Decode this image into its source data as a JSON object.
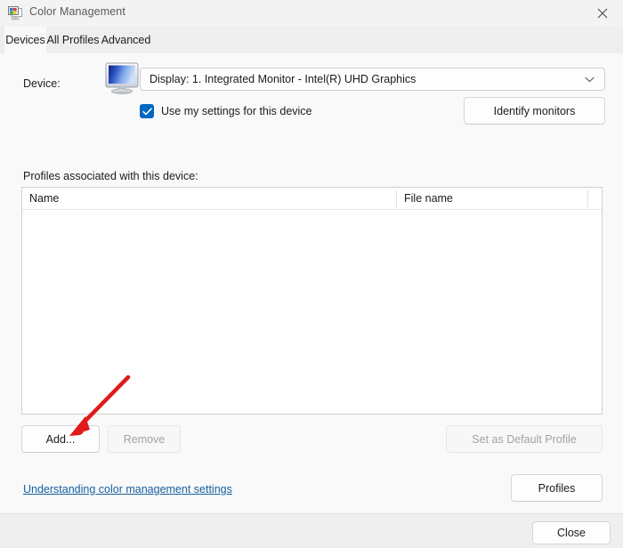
{
  "window": {
    "title": "Color Management",
    "icon": "color-management-icon",
    "close_glyph": "✕"
  },
  "tabs": [
    {
      "label": "Devices",
      "active": true
    },
    {
      "label": "All Profiles",
      "active": false
    },
    {
      "label": "Advanced",
      "active": false
    }
  ],
  "device_section": {
    "label": "Device:",
    "icon": "monitor-icon",
    "selected_device": "Display: 1. Integrated Monitor - Intel(R) UHD Graphics",
    "chevron": "chevron-down-icon",
    "use_my_settings": {
      "label": "Use my settings for this device",
      "checked": true,
      "check_glyph": "✓"
    },
    "identify_monitors_label": "Identify monitors"
  },
  "profiles_section": {
    "caption": "Profiles associated with this device:",
    "columns": [
      "Name",
      "File name"
    ],
    "rows": [],
    "buttons": {
      "add": {
        "label": "Add...",
        "enabled": true
      },
      "remove": {
        "label": "Remove",
        "enabled": false
      },
      "set_default": {
        "label": "Set as Default Profile",
        "enabled": false
      }
    }
  },
  "help_link": "Understanding color management settings",
  "profiles_button": "Profiles",
  "footer": {
    "close_label": "Close"
  },
  "colors": {
    "accent": "#0067c0",
    "link": "#1560a0",
    "annotation_arrow": "#e01b1b",
    "title_bar": "#f3f3f3",
    "tab_strip": "#eeeeee",
    "content": "#f9f9f9",
    "footer": "#efefef"
  }
}
